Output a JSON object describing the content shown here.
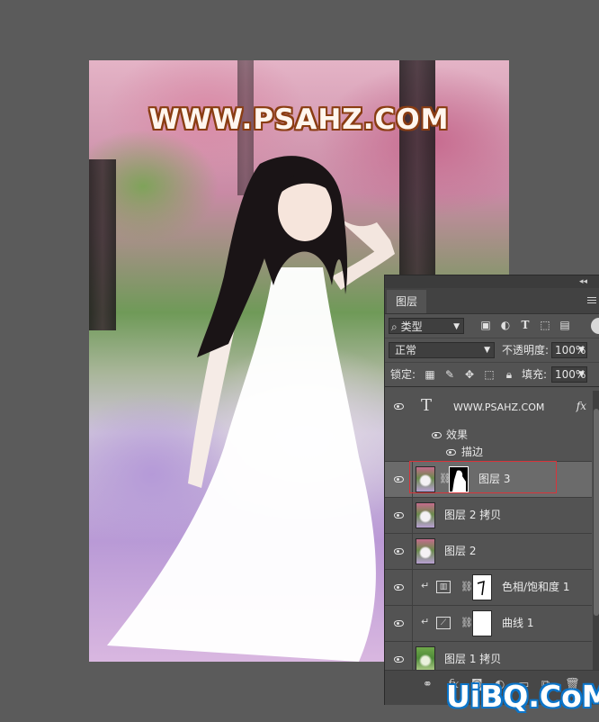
{
  "canvas": {
    "watermark_text": "WWW.PSAHZ.COM"
  },
  "panel": {
    "tab_label": "图层",
    "filter_label": "类型",
    "filter_icons": [
      "image-filter-icon",
      "adjustment-filter-icon",
      "type-filter-icon",
      "shape-filter-icon",
      "smart-object-filter-icon"
    ],
    "blend_mode": "正常",
    "opacity_label": "不透明度:",
    "opacity_value": "100%",
    "lock_label": "锁定:",
    "fill_label": "填充:",
    "fill_value": "100%",
    "layers": [
      {
        "name": "WWW.PSAHZ.COM",
        "kind": "text",
        "fx": "fx",
        "effects_label": "效果",
        "effect_item": "描边"
      },
      {
        "name": "图层 3",
        "kind": "masked",
        "selected": true
      },
      {
        "name": "图层 2 拷贝",
        "kind": "pixel"
      },
      {
        "name": "图层 2",
        "kind": "pixel"
      },
      {
        "name": "色相/饱和度 1",
        "kind": "adjustment",
        "clipped": true
      },
      {
        "name": "曲线 1",
        "kind": "adjustment",
        "clipped": true
      },
      {
        "name": "图层 1 拷贝",
        "kind": "pixel"
      }
    ],
    "bottom_actions": [
      "link-layers-icon",
      "fx-icon",
      "add-mask-icon",
      "new-adjustment-icon",
      "new-group-icon",
      "new-layer-icon",
      "delete-layer-icon"
    ],
    "fx_button_label": "fx"
  },
  "site_logo": "UiBQ.CoM",
  "colors": {
    "background": "#5b5b5b",
    "panel": "#535353",
    "selected_layer": "#6b6b6b",
    "selection_outline": "#d8343a"
  }
}
